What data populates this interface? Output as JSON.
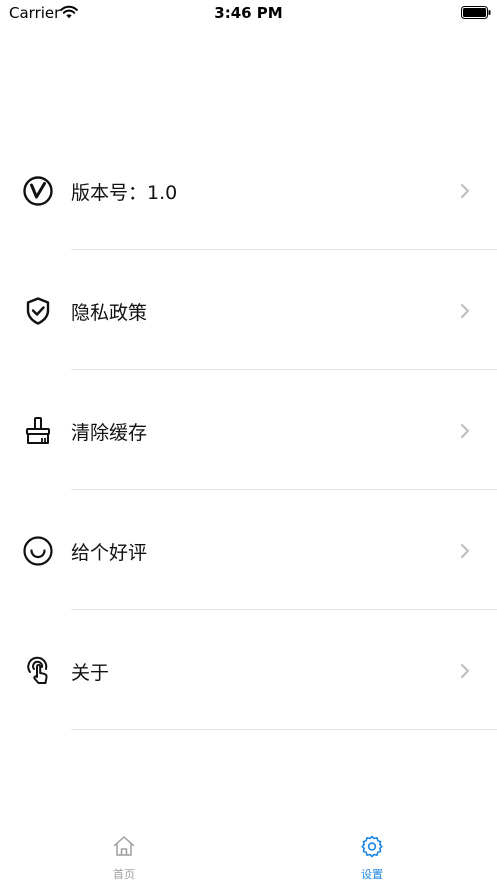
{
  "status_bar": {
    "carrier": "Carrier",
    "time": "3:46 PM"
  },
  "menu": {
    "items": [
      {
        "label": "版本号：1.0",
        "icon": "version-v-icon"
      },
      {
        "label": "隐私政策",
        "icon": "shield-check-icon"
      },
      {
        "label": "清除缓存",
        "icon": "broom-icon"
      },
      {
        "label": "给个好评",
        "icon": "smile-icon"
      },
      {
        "label": "关于",
        "icon": "touch-hand-icon"
      }
    ]
  },
  "tab_bar": {
    "tabs": [
      {
        "label": "首页",
        "icon": "home-icon",
        "active": false
      },
      {
        "label": "设置",
        "icon": "gear-icon",
        "active": true
      }
    ]
  },
  "colors": {
    "accent": "#1e88e5",
    "inactive": "#9e9e9e",
    "divider": "#e4e4e4",
    "chevron": "#bdbdbd"
  }
}
